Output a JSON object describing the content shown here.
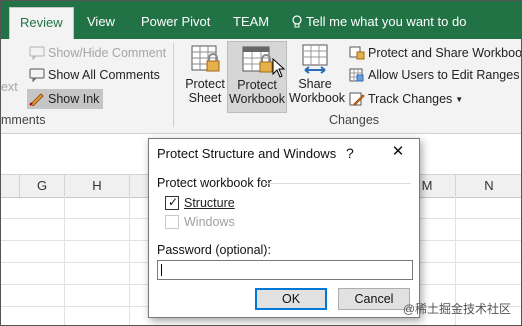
{
  "ribbon": {
    "tabs": [
      "Review",
      "View",
      "Power Pivot",
      "TEAM"
    ],
    "active_tab": "Review",
    "tell_me": "Tell me what you want to do",
    "comments": {
      "partial_label": "ext",
      "show_hide_comment": "Show/Hide Comment",
      "show_all_comments": "Show All Comments",
      "show_ink": "Show Ink",
      "group_label_partial": "mments"
    },
    "changes": {
      "protect_sheet": [
        "Protect",
        "Sheet"
      ],
      "protect_workbook": [
        "Protect",
        "Workbook"
      ],
      "share_workbook": [
        "Share",
        "Workbook"
      ],
      "protect_and_share": "Protect and Share Workbook",
      "allow_users": "Allow Users to Edit Ranges",
      "track_changes": "Track Changes",
      "group_label": "Changes"
    }
  },
  "sheet": {
    "columns_left": [
      "G",
      "H"
    ],
    "columns_right": [
      "M",
      "N"
    ]
  },
  "dialog": {
    "title": "Protect Structure and Windows",
    "help": "?",
    "close": "✕",
    "section": "Protect workbook for",
    "structure_label": "Structure",
    "structure_checked": true,
    "windows_label": "Windows",
    "windows_checked": false,
    "password_label": "Password (optional):",
    "password_value": "",
    "ok": "OK",
    "cancel": "Cancel"
  },
  "watermark": "@稀土掘金技术社区",
  "colors": {
    "ribbon_green": "#217346",
    "ribbon_bg": "#f3f3f3",
    "default_button_border": "#0078d7"
  }
}
